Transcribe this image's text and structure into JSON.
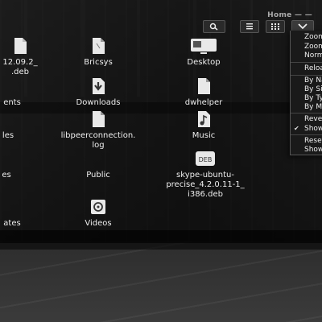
{
  "window": {
    "title": "Home — —"
  },
  "toolbar": {
    "search_icon": "search-icon",
    "list_icon": "list-view-icon",
    "grid_icon": "grid-view-icon",
    "menu_icon": "chevron-down-icon"
  },
  "files": [
    {
      "label": "12.09.2_\n.deb",
      "icon": "package-icon"
    },
    {
      "label": "Bricsys",
      "icon": "folder-icon"
    },
    {
      "label": "Desktop",
      "icon": "desktop-icon"
    },
    {
      "label": "ents",
      "icon": "folder-icon"
    },
    {
      "label": "Downloads",
      "icon": "download-icon"
    },
    {
      "label": "dwhelper",
      "icon": "folder-icon"
    },
    {
      "label": "les",
      "icon": "folder-icon"
    },
    {
      "label": "libpeerconnection.\nlog",
      "icon": "text-file-icon"
    },
    {
      "label": "Music",
      "icon": "music-icon"
    },
    {
      "label": "es",
      "icon": "folder-icon"
    },
    {
      "label": "Public",
      "icon": "folder-icon"
    },
    {
      "label": "skype-ubuntu-\nprecise_4.2.0.11-1_\ni386.deb",
      "icon": "deb-package-icon"
    },
    {
      "label": "ates",
      "icon": "folder-icon"
    },
    {
      "label": "Videos",
      "icon": "video-icon"
    }
  ],
  "menu": {
    "items": [
      {
        "label": "Zoom In"
      },
      {
        "label": "Zoom Out"
      },
      {
        "label": "Normal Size"
      },
      {
        "label": "Reload"
      },
      {
        "label": "By Name"
      },
      {
        "label": "By Size"
      },
      {
        "label": "By Type"
      },
      {
        "label": "By Modification Date"
      },
      {
        "label": "Reversed Order"
      },
      {
        "label": "Show Hidden Files"
      },
      {
        "label": "Reset View to Defaults"
      },
      {
        "label": "Show Sidebar"
      }
    ]
  }
}
